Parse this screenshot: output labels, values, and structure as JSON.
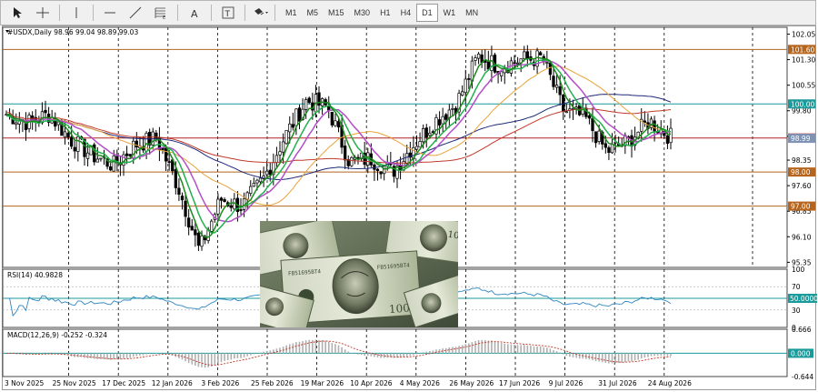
{
  "toolbar": {
    "tools": [
      {
        "name": "cursor-tool",
        "icon": "arrow-cursor-icon"
      },
      {
        "name": "crosshair-tool",
        "icon": "crosshair-icon"
      },
      {
        "name": "vertical-line-tool",
        "icon": "vertical-line-icon"
      },
      {
        "name": "horizontal-line-tool",
        "icon": "horizontal-line-icon"
      },
      {
        "name": "trendline-tool",
        "icon": "trendline-icon"
      },
      {
        "name": "fibonacci-tool",
        "icon": "fibonacci-icon"
      },
      {
        "name": "text-tool",
        "icon": "text-icon"
      },
      {
        "name": "label-tool",
        "icon": "text-label-icon"
      },
      {
        "name": "shapes-menu",
        "icon": "shapes-icon"
      }
    ],
    "timeframes": [
      "M1",
      "M5",
      "M15",
      "M30",
      "H1",
      "H4",
      "D1",
      "W1",
      "MN"
    ],
    "active_timeframe": "D1"
  },
  "main_chart": {
    "header": "#USDX,Daily  98.96 99.04 98.89 99.03",
    "price_ticks": [
      "102.05",
      "101.30",
      "100.55",
      "99.80",
      "99.05",
      "98.35",
      "97.60",
      "96.85",
      "96.10",
      "95.35"
    ],
    "level_tags": [
      {
        "text": "101.60",
        "color": "#b5651d",
        "bg": "#b5651d"
      },
      {
        "text": "100.00",
        "color": "#1a9a9a",
        "bg": "#1a9a9a"
      },
      {
        "text": "99.00",
        "color": "#b22222",
        "bg": "#b22222"
      },
      {
        "text": "98.99",
        "color": "#7f93b5",
        "bg": "#7f93b5"
      },
      {
        "text": "98.00",
        "color": "#b5651d",
        "bg": "#b5651d"
      },
      {
        "text": "97.00",
        "color": "#b5651d",
        "bg": "#b5651d"
      }
    ],
    "image_alt": "Stack of US 100 dollar bills"
  },
  "rsi": {
    "header": "RSI(14) 40.9828",
    "ticks": [
      "100",
      "70",
      "30",
      "0"
    ],
    "level_tag": "50.0000"
  },
  "macd": {
    "header": "MACD(12,26,9) -0.252 -0.324",
    "ticks": [
      "0.666",
      "-0.644"
    ],
    "level_tag": "0.000"
  },
  "x_axis": [
    "3 Nov 2025",
    "25 Nov 2025",
    "17 Dec 2025",
    "12 Jan 2026",
    "3 Feb 2026",
    "25 Feb 2026",
    "19 Mar 2026",
    "10 Apr 2026",
    "4 May 2026",
    "26 May 2026",
    "17 Jun 2026",
    "9 Jul 2026",
    "31 Jul 2026",
    "24 Aug 2026"
  ],
  "chart_data": {
    "type": "candlestick",
    "symbol": "#USDX",
    "timeframe": "Daily",
    "ohlc_last": {
      "open": 98.96,
      "high": 99.04,
      "low": 98.89,
      "close": 99.03
    },
    "horizontal_levels": [
      101.6,
      100.0,
      99.0,
      98.0,
      97.0
    ],
    "y_range": [
      95.2,
      102.25
    ],
    "close_path": [
      {
        "date": "3 Nov 2025",
        "close": 99.7
      },
      {
        "date": "15 Nov 2025",
        "close": 99.45
      },
      {
        "date": "25 Nov 2025",
        "close": 99.7
      },
      {
        "date": "5 Dec 2025",
        "close": 98.95
      },
      {
        "date": "17 Dec 2025",
        "close": 98.5
      },
      {
        "date": "27 Dec 2025",
        "close": 98.2
      },
      {
        "date": "5 Jan 2026",
        "close": 98.8
      },
      {
        "date": "12 Jan 2026",
        "close": 99.0
      },
      {
        "date": "20 Jan 2026",
        "close": 97.6
      },
      {
        "date": "27 Jan 2026",
        "close": 95.7
      },
      {
        "date": "3 Feb 2026",
        "close": 97.2
      },
      {
        "date": "13 Feb 2026",
        "close": 97.0
      },
      {
        "date": "25 Feb 2026",
        "close": 97.8
      },
      {
        "date": "7 Mar 2026",
        "close": 99.05
      },
      {
        "date": "19 Mar 2026",
        "close": 100.1
      },
      {
        "date": "29 Mar 2026",
        "close": 99.9
      },
      {
        "date": "10 Apr 2026",
        "close": 98.3
      },
      {
        "date": "22 Apr 2026",
        "close": 98.4
      },
      {
        "date": "4 May 2026",
        "close": 98.0
      },
      {
        "date": "15 May 2026",
        "close": 98.8
      },
      {
        "date": "26 May 2026",
        "close": 99.5
      },
      {
        "date": "5 Jun 2026",
        "close": 100.0
      },
      {
        "date": "17 Jun 2026",
        "close": 101.4
      },
      {
        "date": "27 Jun 2026",
        "close": 101.1
      },
      {
        "date": "9 Jul 2026",
        "close": 101.3
      },
      {
        "date": "18 Jul 2026",
        "close": 101.35
      },
      {
        "date": "25 Jul 2026",
        "close": 99.8
      },
      {
        "date": "31 Jul 2026",
        "close": 99.6
      },
      {
        "date": "10 Aug 2026",
        "close": 98.6
      },
      {
        "date": "18 Aug 2026",
        "close": 98.9
      },
      {
        "date": "24 Aug 2026",
        "close": 99.5
      },
      {
        "date": "28 Aug 2026",
        "close": 99.03
      }
    ],
    "rsi_range": [
      0,
      100
    ],
    "rsi_levels": [
      30,
      50,
      70
    ],
    "rsi_last": 40.9828,
    "macd": {
      "main": -0.252,
      "signal": -0.324,
      "range": [
        -0.644,
        0.666
      ]
    }
  },
  "colors": {
    "candle": "#000000",
    "ma_fast": "#1d8a1d",
    "ma_fast2": "#22b14c",
    "ma_purple": "#b44ec8",
    "ma_orange": "#e8a33a",
    "ma_navy": "#1e2a78",
    "ma_red": "#c0392b",
    "rsi_line": "#2e86c1",
    "macd_hist": "#b0b0b0",
    "macd_signal": "#c0392b"
  }
}
